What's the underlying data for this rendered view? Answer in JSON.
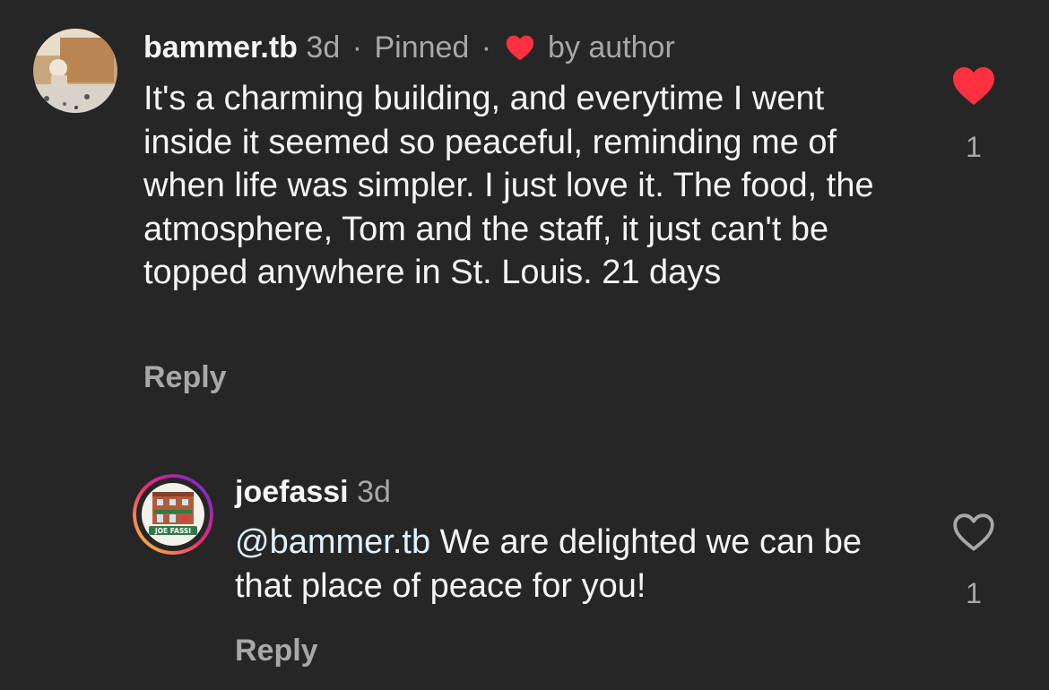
{
  "comments": [
    {
      "username": "bammer.tb",
      "time": "3d",
      "separator": "·",
      "pinned_label": "Pinned",
      "by_author_label": "by author",
      "text": "It's a charming building, and everytime I went inside it seemed so peaceful, reminding me of when life was simpler. I just love it. The food, the atmosphere, Tom and the staff, it just can't be topped anywhere in St. Louis. 21 days",
      "reply_label": "Reply",
      "like_count": "1",
      "liked": true
    },
    {
      "username": "joefassi",
      "time": "3d",
      "mention": "@bammer.tb",
      "text": " We are delighted we can be that place of peace for you!",
      "reply_label": "Reply",
      "like_count": "1",
      "liked": false,
      "avatar_label": "JOE FASSI"
    }
  ],
  "colors": {
    "background": "#262626",
    "heart_red": "#ff3040",
    "secondary_text": "#a8a8a8",
    "mention": "#e0f1ff"
  }
}
